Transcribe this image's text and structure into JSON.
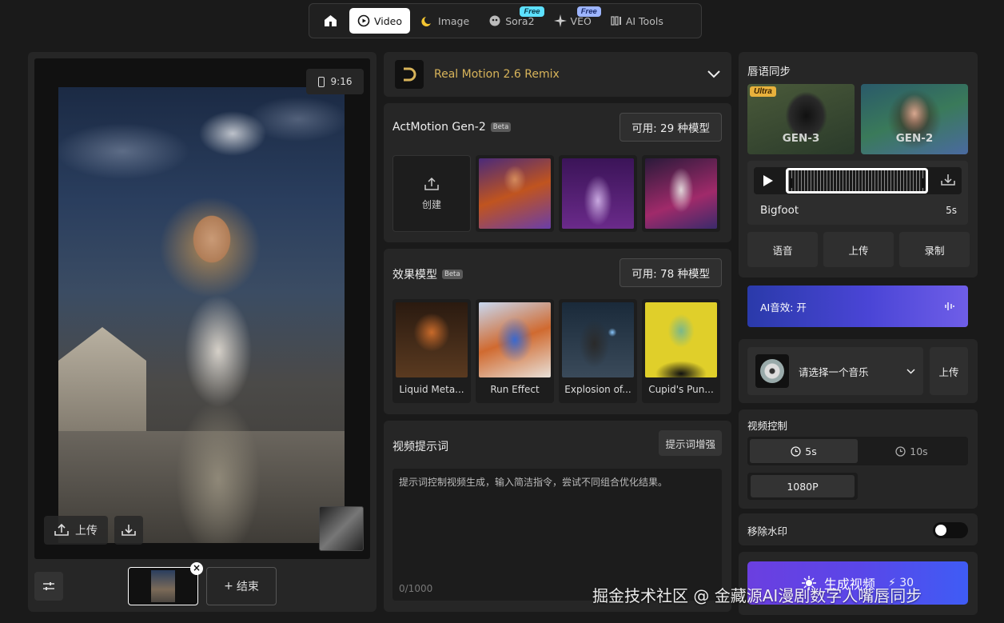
{
  "nav": {
    "home_icon": "home-icon",
    "tabs": [
      {
        "label": "Video",
        "icon": "video-icon",
        "active": true
      },
      {
        "label": "Image",
        "icon": "moon-icon"
      },
      {
        "label": "Sora2",
        "icon": "sora-icon",
        "tag": "Free"
      },
      {
        "label": "VEO",
        "icon": "sparkle-icon",
        "tag": "Free"
      },
      {
        "label": "AI Tools",
        "icon": "tools-icon"
      }
    ]
  },
  "preview": {
    "aspect_ratio": "9:16",
    "upload_label": "上传",
    "end_label": "结束"
  },
  "model": {
    "name": "Real Motion 2.6 Remix"
  },
  "actmotion": {
    "title": "ActMotion Gen-2",
    "badge": "Beta",
    "available": "可用: 29 种模型",
    "create_label": "创建"
  },
  "effects": {
    "title": "效果模型",
    "badge": "Beta",
    "available": "可用: 78 种模型",
    "items": [
      {
        "label": "Liquid Meta..."
      },
      {
        "label": "Run Effect"
      },
      {
        "label": "Explosion of..."
      },
      {
        "label": "Cupid's Pun..."
      }
    ]
  },
  "prompt": {
    "title": "视频提示词",
    "enhance_label": "提示词增强",
    "placeholder": "提示词控制视频生成，输入简洁指令，尝试不同组合优化结果。",
    "count": "0/1000"
  },
  "lipsync": {
    "title": "唇语同步",
    "models": [
      {
        "label": "GEN-3",
        "tag": "Ultra"
      },
      {
        "label": "GEN-2"
      }
    ],
    "audio_name": "Bigfoot",
    "audio_duration": "5s",
    "sources": [
      "语音",
      "上传",
      "录制"
    ]
  },
  "ai_sfx": {
    "label": "AI音效: 开"
  },
  "music": {
    "placeholder": "请选择一个音乐",
    "upload_label": "上传"
  },
  "video_control": {
    "title": "视频控制",
    "durations": [
      "5s",
      "10s"
    ],
    "selected_duration": "5s",
    "resolution": "1080P"
  },
  "watermark_removal": {
    "label": "移除水印",
    "enabled": false
  },
  "generate": {
    "label": "生成视频",
    "cost": "30"
  },
  "site_watermark": "掘金技术社区 @ 金藏源AI漫剧数字人嘴唇同步",
  "colors": {
    "accent_gold": "#d8b45a",
    "free_tag": "#5de1ff",
    "ultra_tag": "#e8b13c",
    "generate_start": "#6b3fe0",
    "generate_end": "#3f5cf5"
  }
}
